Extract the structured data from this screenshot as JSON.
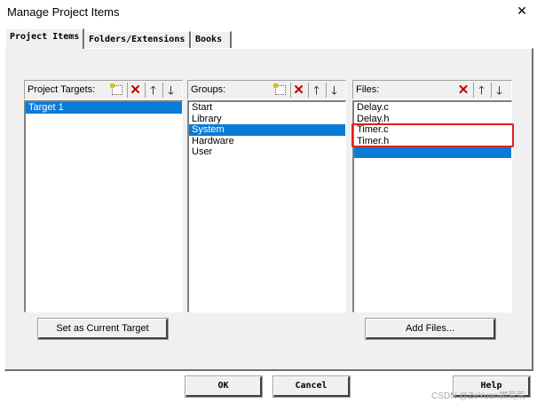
{
  "window": {
    "title": "Manage Project Items"
  },
  "tabs": [
    {
      "label": "Project Items",
      "active": true
    },
    {
      "label": "Folders/Extensions",
      "active": false
    },
    {
      "label": "Books",
      "active": false
    }
  ],
  "targets": {
    "label": "Project Targets:",
    "items": [
      "Target 1"
    ],
    "selected_index": 0,
    "button_label": "Set as Current Target"
  },
  "groups": {
    "label": "Groups:",
    "items": [
      "Start",
      "Library",
      "System",
      "Hardware",
      "User"
    ],
    "selected_index": 2
  },
  "files": {
    "label": "Files:",
    "items": [
      "Delay.c",
      "Delay.h",
      "Timer.c",
      "Timer.h",
      ""
    ],
    "selected_index": 4,
    "button_label": "Add Files..."
  },
  "footer": {
    "ok_label": "OK",
    "cancel_label": "Cancel",
    "help_label": "Help"
  },
  "watermark": "CSDN @ZeYuan拔荒荒",
  "colors": {
    "selection": "#0a7bd7",
    "highlight_box": "#e02020",
    "delete_icon": "#c00000"
  },
  "icons": {
    "close": "close-icon",
    "new": "new-item-icon",
    "delete": "delete-icon",
    "up": "move-up-icon",
    "down": "move-down-icon"
  }
}
